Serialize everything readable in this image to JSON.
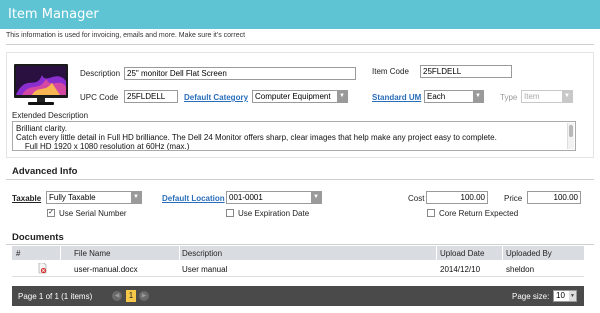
{
  "header": {
    "title": "Item Manager"
  },
  "info_text": "This information is used for invoicing, emails and more. Make sure it's correct",
  "item": {
    "image_icon": "monitor-image",
    "description_label": "Description",
    "description_value": "25\" monitor Dell Flat Screen",
    "item_code_label": "Item Code",
    "item_code_value": "25FLDELL",
    "upc_label": "UPC Code",
    "upc_value": "25FLDELL",
    "category_label": "Default Category",
    "category_value": "Computer Equipment",
    "um_label": "Standard UM",
    "um_value": "Each",
    "type_label": "Type",
    "type_value": "Item",
    "ext_desc_label": "Extended Description",
    "ext_desc_lines": [
      "Brilliant clarity.",
      "Catch every little detail in Full HD brilliance. The Dell 24 Monitor offers sharp, clear images that help make any project easy to complete.",
      "    Full HD 1920 x 1080 resolution at 60Hz (max.)"
    ]
  },
  "advanced": {
    "title": "Advanced Info",
    "taxable_label": "Taxable",
    "taxable_value": "Fully Taxable",
    "location_label": "Default Location",
    "location_value": "001-0001",
    "cost_label": "Cost",
    "cost_value": "100.00",
    "price_label": "Price",
    "price_value": "100.00",
    "serial_label": "Use Serial Number",
    "serial_checked": true,
    "expiration_label": "Use Expiration Date",
    "expiration_checked": false,
    "core_label": "Core Return Expected",
    "core_checked": false
  },
  "documents": {
    "title": "Documents",
    "columns": [
      "#",
      "File Name",
      "Description",
      "Upload Date",
      "Uploaded By"
    ],
    "rows": [
      {
        "icon": "delete-icon",
        "file_name": "user-manual.docx",
        "description": "User manual",
        "upload_date": "2014/12/10",
        "uploaded_by": "sheldon"
      }
    ]
  },
  "pager": {
    "summary": "Page 1 of 1 (1 items)",
    "current_page": "1",
    "page_size_label": "Page size:",
    "page_size_value": "10"
  },
  "colors": {
    "header": "#5ec4d3",
    "link": "#2a6ebb",
    "pager_bg": "#4a4a4a",
    "current_page": "#f5c84a"
  }
}
